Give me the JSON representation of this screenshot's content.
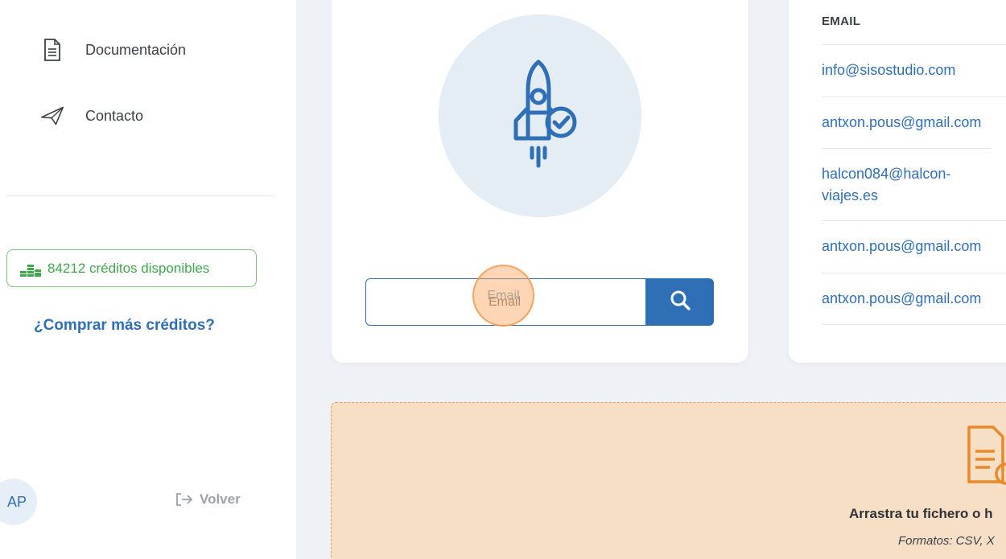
{
  "sidebar": {
    "nav": [
      {
        "label": "Documentación",
        "icon": "document-icon"
      },
      {
        "label": "Contacto",
        "icon": "paper-plane-icon"
      }
    ],
    "credits_label": "84212 créditos disponibles",
    "buy_link": "¿Comprar más créditos?",
    "avatar_initials": "AP",
    "back_label": "Volver"
  },
  "search": {
    "placeholder": "Email",
    "typed": "Email"
  },
  "email_table": {
    "header": "EMAIL",
    "rows": [
      "info@sisostudio.com",
      "antxon.pous@gmail.com",
      "halcon084@halcon-viajes.es",
      "antxon.pous@gmail.com",
      "antxon.pous@gmail.com"
    ]
  },
  "dropzone": {
    "text": "Arrastra tu fichero o h",
    "formats": "Formatos: CSV, X"
  },
  "colors": {
    "accent": "#2f6fb5",
    "credits_green": "#3fa84a",
    "dropzone_bg": "#f6dfc5"
  }
}
